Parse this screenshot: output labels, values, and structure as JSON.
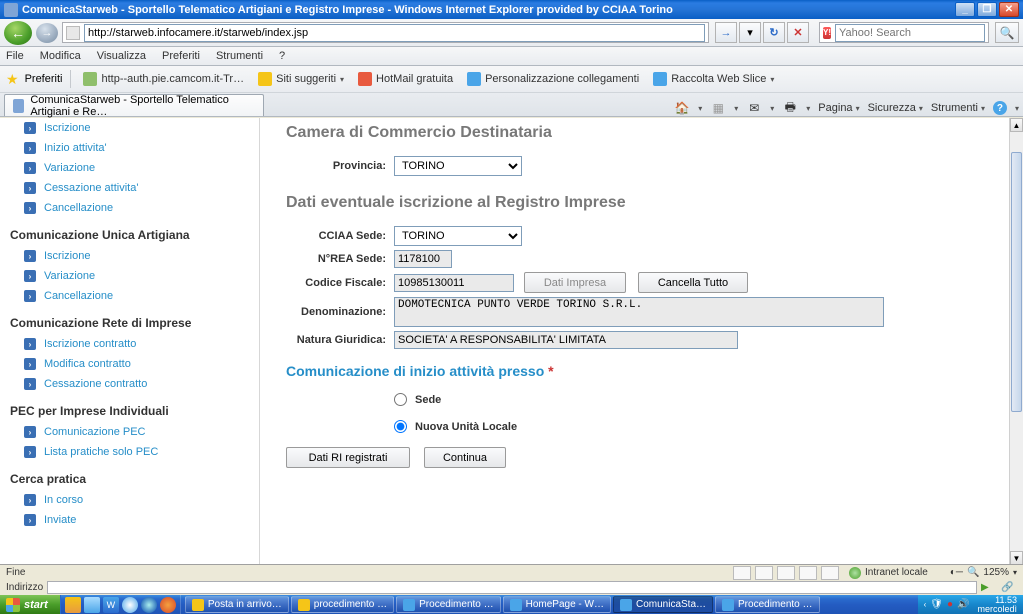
{
  "window": {
    "title": "ComunicaStarweb - Sportello Telematico Artigiani e Registro Imprese - Windows Internet Explorer provided by CCIAA Torino"
  },
  "address": {
    "url": "http://starweb.infocamere.it/starweb/index.jsp"
  },
  "search": {
    "placeholder": "Yahoo! Search",
    "go_glyph": "🔍"
  },
  "menu": {
    "file": "File",
    "edit": "Modifica",
    "view": "Visualizza",
    "fav": "Preferiti",
    "tools": "Strumenti",
    "help": "?"
  },
  "favbar": {
    "label": "Preferiti",
    "items": [
      "http--auth.pie.camcom.it-Tr…",
      "Siti suggeriti",
      "HotMail gratuita",
      "Personalizzazione collegamenti",
      "Raccolta Web Slice"
    ]
  },
  "tab": {
    "label": "ComunicaStarweb - Sportello Telematico Artigiani e Re…"
  },
  "cmdbar": {
    "pagina": "Pagina",
    "sicurezza": "Sicurezza",
    "strumenti": "Strumenti"
  },
  "sidebar": {
    "items0": [
      "Iscrizione",
      "Inizio attivita'",
      "Variazione",
      "Cessazione attivita'",
      "Cancellazione"
    ],
    "head1": "Comunicazione Unica Artigiana",
    "items1": [
      "Iscrizione",
      "Variazione",
      "Cancellazione"
    ],
    "head2": "Comunicazione Rete di Imprese",
    "items2": [
      "Iscrizione contratto",
      "Modifica contratto",
      "Cessazione contratto"
    ],
    "head3": "PEC per Imprese Individuali",
    "items3": [
      "Comunicazione PEC",
      "Lista pratiche solo PEC"
    ],
    "head4": "Cerca pratica",
    "items4": [
      "In corso",
      "Inviate"
    ]
  },
  "main": {
    "sec1": "Camera di Commercio Destinataria",
    "provincia_lbl": "Provincia:",
    "provincia_val": "TORINO",
    "sec2": "Dati eventuale iscrizione al Registro Imprese",
    "cciaa_lbl": "CCIAA Sede:",
    "cciaa_val": "TORINO",
    "nrea_lbl": "N°REA Sede:",
    "nrea_val": "1178100",
    "cf_lbl": "Codice Fiscale:",
    "cf_val": "10985130011",
    "dati_impresa": "Dati Impresa",
    "cancella": "Cancella Tutto",
    "denom_lbl": "Denominazione:",
    "denom_val": "DOMOTECNICA PUNTO VERDE TORINO S.R.L.",
    "natura_lbl": "Natura Giuridica:",
    "natura_val": "SOCIETA' A RESPONSABILITA' LIMITATA",
    "comm_title": "Comunicazione di inizio attività presso",
    "radio_sede": "Sede",
    "radio_nuova": "Nuova Unità Locale",
    "btn_dati_ri": "Dati RI registrati",
    "btn_continua": "Continua"
  },
  "status": {
    "fine": "Fine",
    "zone": "Intranet locale",
    "zoom": "125%",
    "indirizzo": "Indirizzo"
  },
  "taskbar": {
    "start": "start",
    "tasks": [
      "Posta in arrivo…",
      "procedimento …",
      "Procedimento …",
      "HomePage - W…",
      "ComunicaSta…",
      "Procedimento …"
    ],
    "time": "11.53",
    "day": "mercoledì"
  }
}
